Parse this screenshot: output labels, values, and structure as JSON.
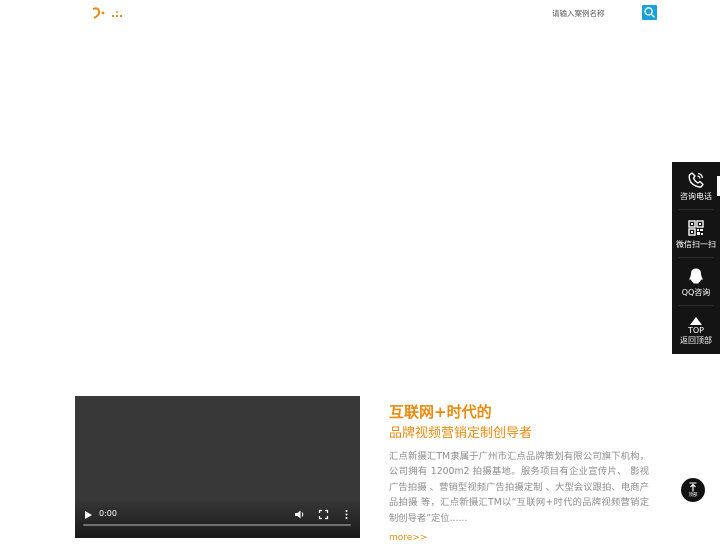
{
  "search": {
    "placeholder": "请输入案例名称"
  },
  "side_bar": {
    "items": [
      {
        "label": "咨询电话",
        "icon": "phone-icon"
      },
      {
        "label": "微信扫一扫",
        "icon": "qrcode-icon"
      },
      {
        "label": "QQ咨询",
        "icon": "qq-icon"
      },
      {
        "label_top": "TOP",
        "label": "返回顶部",
        "icon": "arrow-up-icon"
      }
    ]
  },
  "video": {
    "time": "0:00"
  },
  "intro": {
    "title": "互联网+时代的",
    "subtitle": "品牌视频营销定制创导者",
    "description": "汇点新摄汇TM隶属于广州市汇点品牌策划有限公司旗下机构，公司拥有 1200m2 拍摄基地。服务项目有企业宣传片、 影视广告拍摄 、营销型视频广告拍摄定制 、大型会议跟拍、电商产品拍摄 等，汇点新摄汇TM以“互联网+时代的品牌视频营销定制创导者”定位......",
    "more": "more>>"
  },
  "back_top": {
    "label": "顶部"
  },
  "colors": {
    "accent": "#e98c12",
    "search_button": "#1aa0db",
    "side_bar": "#141414"
  }
}
